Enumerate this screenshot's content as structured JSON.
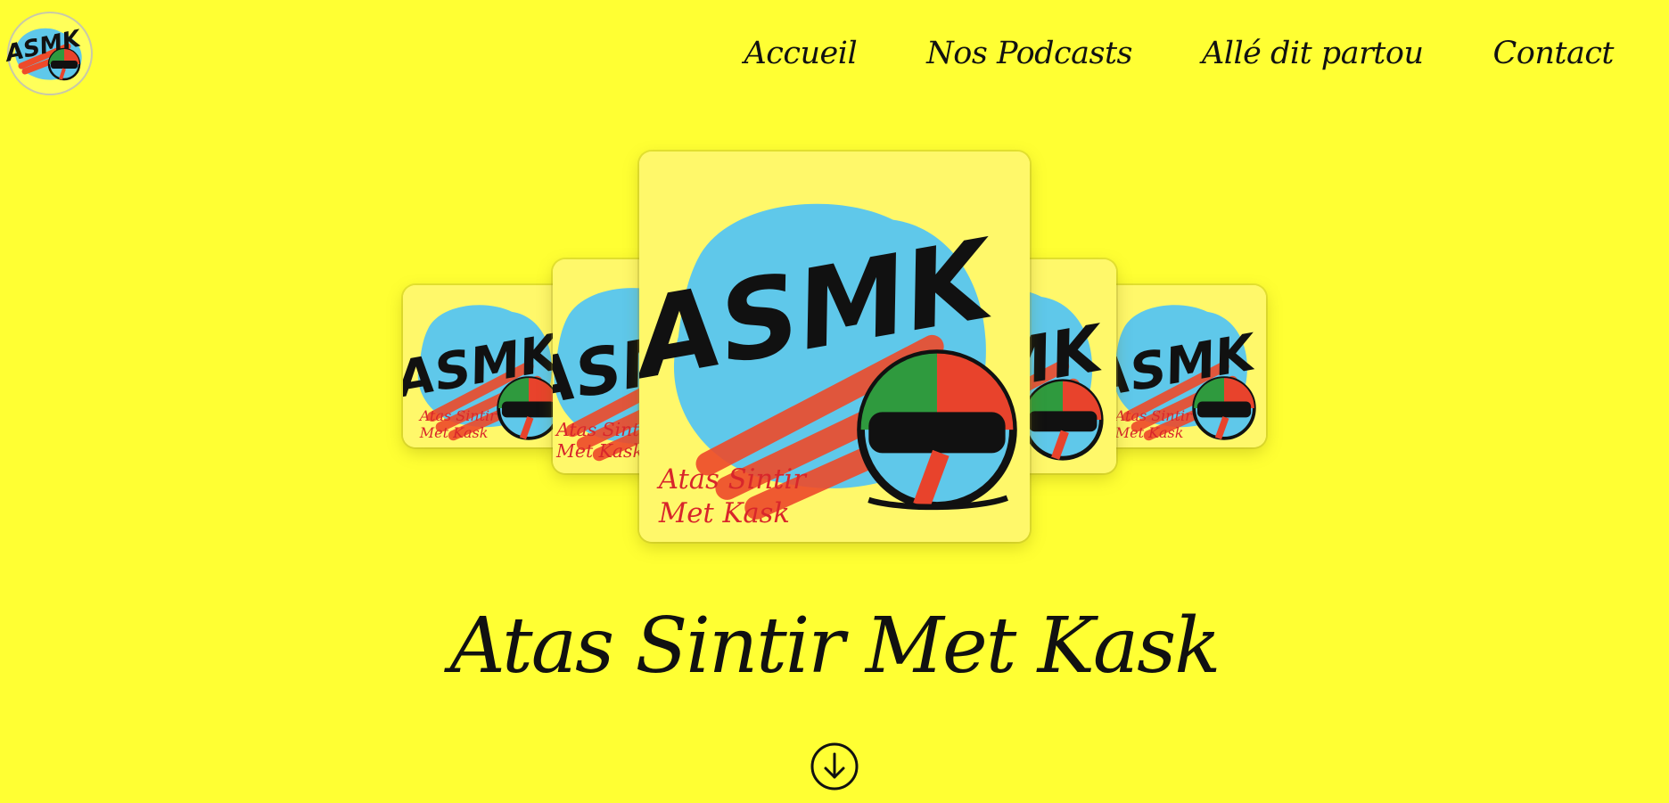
{
  "header": {
    "logo_text": "ASMK",
    "nav": [
      {
        "label": "Accueil"
      },
      {
        "label": "Nos Podcasts"
      },
      {
        "label": "Allé dit partou"
      },
      {
        "label": "Contact"
      }
    ]
  },
  "carousel": {
    "cover_text": "ASMK",
    "cover_subtitle_line1": "Atas Sintir",
    "cover_subtitle_line2": "Met Kask",
    "cover_count": 5,
    "active_index": 2
  },
  "main": {
    "title": "Atas Sintir Met Kask",
    "scroll_icon": "arrow-down-circle-icon"
  },
  "colors": {
    "background": "#ffff33",
    "text": "#111111",
    "cover_splash": "#5fc8ea",
    "cover_stroke": "#ee4a2a",
    "subtitle": "#d8262b",
    "helmet_green": "#2f9a3e",
    "helmet_red": "#e8432c"
  }
}
